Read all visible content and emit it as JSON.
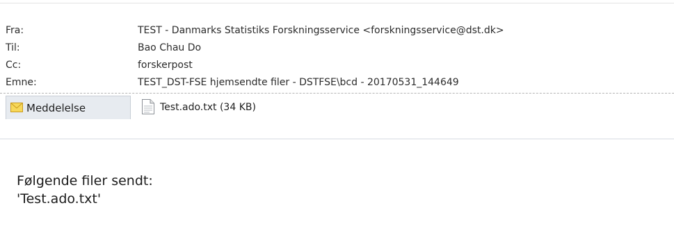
{
  "header": {
    "rows": [
      {
        "label": "Fra:",
        "value": "TEST - Danmarks Statistiks Forskningsservice <forskningsservice@dst.dk>"
      },
      {
        "label": "Til:",
        "value": "Bao Chau Do"
      },
      {
        "label": "Cc:",
        "value": "forskerpost"
      },
      {
        "label": "Emne:",
        "value": "TEST_DST-FSE hjemsendte filer - DSTFSE\\bcd - 20170531_144649"
      }
    ]
  },
  "tabs": {
    "message_label": "Meddelelse",
    "message_icon": "envelope-icon",
    "attachment_label": "Test.ado.txt (34 KB)",
    "attachment_icon": "text-file-icon"
  },
  "body": {
    "line1": "Følgende filer sendt:",
    "line2": "'Test.ado.txt'"
  }
}
